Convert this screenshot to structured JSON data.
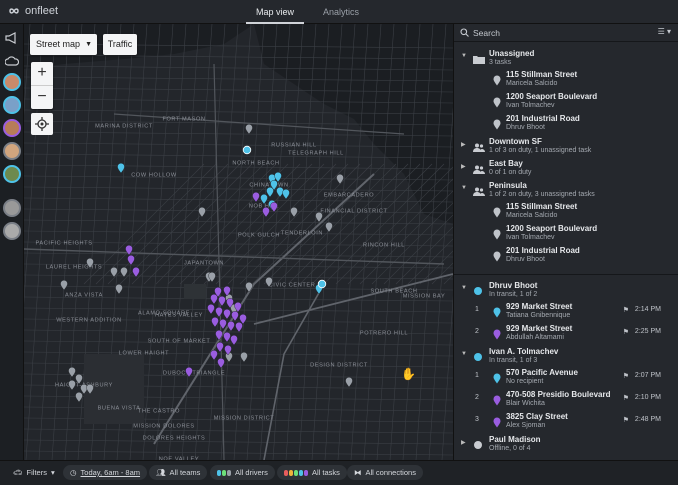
{
  "app": {
    "name": "onfleet"
  },
  "tabs": [
    {
      "label": "Map view"
    },
    {
      "label": "Analytics"
    }
  ],
  "map": {
    "style_select": "Street map",
    "traffic": "Traffic",
    "zoom_in": "+",
    "zoom_out": "−",
    "labels": [
      "FORT MASON",
      "MARINA DISTRICT",
      "RUSSIAN HILL",
      "NORTH BEACH",
      "TELEGRAPH HILL",
      "COW HOLLOW",
      "NOB HILL",
      "EMBARCADERO",
      "FINANCIAL DISTRICT",
      "PACIFIC HEIGHTS",
      "POLK GULCH",
      "TENDERLOIN",
      "CHINATOWN",
      "RINCON HILL",
      "LAUREL HEIGHTS",
      "JAPANTOWN",
      "CIVIC CENTER",
      "SOUTH BEACH",
      "ANZA VISTA",
      "WESTERN ADDITION",
      "HAYES VALLEY",
      "ALAMO SQUARE",
      "SOUTH OF MARKET",
      "MISSION BAY",
      "DUBOCE TRIANGLE",
      "DESIGN DISTRICT",
      "MISSION DISTRICT",
      "THE CASTRO",
      "HAIGHT-ASHBURY",
      "DOLORES HEIGHTS",
      "MISSION DOLORES",
      "BUENA VISTA",
      "NOE VALLEY",
      "POTRERO HILL",
      "LOWER HAIGHT"
    ]
  },
  "panel": {
    "search_placeholder": "Search",
    "groups": [
      {
        "title": "Unassigned",
        "sub": "3 tasks",
        "icon": "folder-icon",
        "tasks": [
          {
            "addr": "115 Stillman Street",
            "name": "Maricela Salcido"
          },
          {
            "addr": "1200 Seaport Boulevard",
            "name": "Ivan Tolmachev"
          },
          {
            "addr": "201 Industrial Road",
            "name": "Dhruv Bhoot"
          }
        ]
      },
      {
        "title": "Downtown SF",
        "sub": "1 of 3 on duty, 1 unassigned task",
        "icon": "team-icon"
      },
      {
        "title": "East Bay",
        "sub": "0 of 1 on duty",
        "icon": "team-icon"
      },
      {
        "title": "Peninsula",
        "sub": "1 of 2 on duty, 3 unassigned tasks",
        "icon": "team-icon",
        "tasks": [
          {
            "addr": "115 Stillman Street",
            "name": "Maricela Salcido"
          },
          {
            "addr": "1200 Seaport Boulevard",
            "name": "Ivan Tolmachev"
          },
          {
            "addr": "201 Industrial Road",
            "name": "Dhruv Bhoot"
          }
        ]
      },
      {
        "title": "Dhruv Bhoot",
        "sub": "In transit, 1 of 2",
        "icon": "driver-dot",
        "tasks": [
          {
            "num": "1",
            "addr": "929 Market Street",
            "name": "Tatiana Gnibennique",
            "eta": "2:14 PM",
            "color": "#4ec2e8"
          },
          {
            "num": "2",
            "addr": "929 Market Street",
            "name": "Abdullah Altamami",
            "eta": "2:25 PM",
            "color": "#9a5de0"
          }
        ]
      },
      {
        "title": "Ivan A. Tolmachev",
        "sub": "In transit, 1 of 3",
        "icon": "driver-dot",
        "tasks": [
          {
            "num": "1",
            "addr": "570 Pacific Avenue",
            "name": "No recipient",
            "eta": "2:07 PM",
            "color": "#4ec2e8"
          },
          {
            "num": "2",
            "addr": "470-508 Presidio Boulevard",
            "name": "Blair Wichita",
            "eta": "2:10 PM",
            "color": "#9a5de0"
          },
          {
            "num": "3",
            "addr": "3825 Clay Street",
            "name": "Alex Sjoman",
            "eta": "2:48 PM",
            "color": "#9a5de0"
          }
        ]
      },
      {
        "title": "Paul Madison",
        "sub": "Offline, 0 of 4",
        "icon": "driver-dot-offline"
      }
    ]
  },
  "bottom": {
    "filters": "Filters",
    "date": "Today, 6am - 8am",
    "teams": "All teams",
    "drivers": "All drivers",
    "tasks": "All tasks",
    "connections": "All connections"
  },
  "colors": {
    "active": "#4ec2e8",
    "assigned": "#9a5de0",
    "unassigned": "#9aa0a8"
  }
}
